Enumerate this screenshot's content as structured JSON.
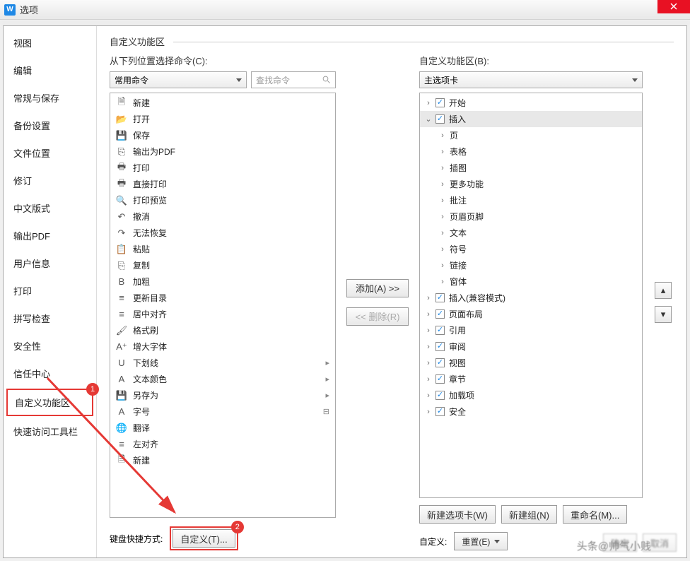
{
  "titlebar": {
    "title": "选项",
    "app_icon": "W"
  },
  "sidebar": {
    "items": [
      "视图",
      "编辑",
      "常规与保存",
      "备份设置",
      "文件位置",
      "修订",
      "中文版式",
      "输出PDF",
      "用户信息",
      "打印",
      "拼写检查",
      "安全性",
      "信任中心",
      "自定义功能区",
      "快速访问工具栏"
    ],
    "selected": "自定义功能区"
  },
  "section_title": "自定义功能区",
  "left": {
    "label": "从下列位置选择命令(C):",
    "dropdown": "常用命令",
    "search_placeholder": "查找命令",
    "commands": [
      {
        "icon": "doc",
        "label": "新建",
        "sub": false
      },
      {
        "icon": "folder",
        "label": "打开",
        "sub": false
      },
      {
        "icon": "disk",
        "label": "保存",
        "sub": false
      },
      {
        "icon": "pdf",
        "label": "输出为PDF",
        "sub": false
      },
      {
        "icon": "print",
        "label": "打印",
        "sub": false
      },
      {
        "icon": "print2",
        "label": "直接打印",
        "sub": false
      },
      {
        "icon": "preview",
        "label": "打印预览",
        "sub": false
      },
      {
        "icon": "undo",
        "label": "撤消",
        "sub": false
      },
      {
        "icon": "redo",
        "label": "无法恢复",
        "sub": false
      },
      {
        "icon": "paste",
        "label": "粘贴",
        "sub": false
      },
      {
        "icon": "copy",
        "label": "复制",
        "sub": false
      },
      {
        "icon": "bold",
        "label": "加粗",
        "sub": false
      },
      {
        "icon": "toc",
        "label": "更新目录",
        "sub": false
      },
      {
        "icon": "center",
        "label": "居中对齐",
        "sub": false
      },
      {
        "icon": "brush",
        "label": "格式刷",
        "sub": false
      },
      {
        "icon": "fontinc",
        "label": "增大字体",
        "sub": false
      },
      {
        "icon": "underline",
        "label": "下划线",
        "sub": true
      },
      {
        "icon": "fontcolor",
        "label": "文本颜色",
        "sub": true
      },
      {
        "icon": "saveas",
        "label": "另存为",
        "sub": true
      },
      {
        "icon": "fontsize",
        "label": "字号",
        "sub": "combo"
      },
      {
        "icon": "translate",
        "label": "翻译",
        "sub": false
      },
      {
        "icon": "alignleft",
        "label": "左对齐",
        "sub": false
      },
      {
        "icon": "doc",
        "label": "新建",
        "sub": false
      }
    ]
  },
  "mid": {
    "add": "添加(A) >>",
    "remove": "<< 删除(R)"
  },
  "right": {
    "label": "自定义功能区(B):",
    "dropdown": "主选项卡",
    "tree": [
      {
        "level": 0,
        "exp": ">",
        "check": true,
        "label": "开始"
      },
      {
        "level": 0,
        "exp": "v",
        "check": true,
        "label": "插入",
        "selected": true
      },
      {
        "level": 1,
        "exp": ">",
        "check": null,
        "label": "页"
      },
      {
        "level": 1,
        "exp": ">",
        "check": null,
        "label": "表格"
      },
      {
        "level": 1,
        "exp": ">",
        "check": null,
        "label": "插图"
      },
      {
        "level": 1,
        "exp": ">",
        "check": null,
        "label": "更多功能"
      },
      {
        "level": 1,
        "exp": ">",
        "check": null,
        "label": "批注"
      },
      {
        "level": 1,
        "exp": ">",
        "check": null,
        "label": "页眉页脚"
      },
      {
        "level": 1,
        "exp": ">",
        "check": null,
        "label": "文本"
      },
      {
        "level": 1,
        "exp": ">",
        "check": null,
        "label": "符号"
      },
      {
        "level": 1,
        "exp": ">",
        "check": null,
        "label": "链接"
      },
      {
        "level": 1,
        "exp": ">",
        "check": null,
        "label": "窗体"
      },
      {
        "level": 0,
        "exp": ">",
        "check": true,
        "label": "插入(兼容模式)"
      },
      {
        "level": 0,
        "exp": ">",
        "check": true,
        "label": "页面布局"
      },
      {
        "level": 0,
        "exp": ">",
        "check": true,
        "label": "引用"
      },
      {
        "level": 0,
        "exp": ">",
        "check": true,
        "label": "审阅"
      },
      {
        "level": 0,
        "exp": ">",
        "check": true,
        "label": "视图"
      },
      {
        "level": 0,
        "exp": ">",
        "check": true,
        "label": "章节"
      },
      {
        "level": 0,
        "exp": ">",
        "check": true,
        "label": "加载项"
      },
      {
        "level": 0,
        "exp": ">",
        "check": true,
        "label": "安全"
      }
    ],
    "btn_newtab": "新建选项卡(W)",
    "btn_newgroup": "新建组(N)",
    "btn_rename": "重命名(M)...",
    "custom_label": "自定义:",
    "btn_reset": "重置(E)"
  },
  "kbd": {
    "label": "键盘快捷方式:",
    "btn": "自定义(T)..."
  },
  "dialog_btns": {
    "ok": "确定",
    "cancel": "取消"
  },
  "badges": {
    "one": "1",
    "two": "2"
  },
  "watermark": "头条@帅气小贱"
}
